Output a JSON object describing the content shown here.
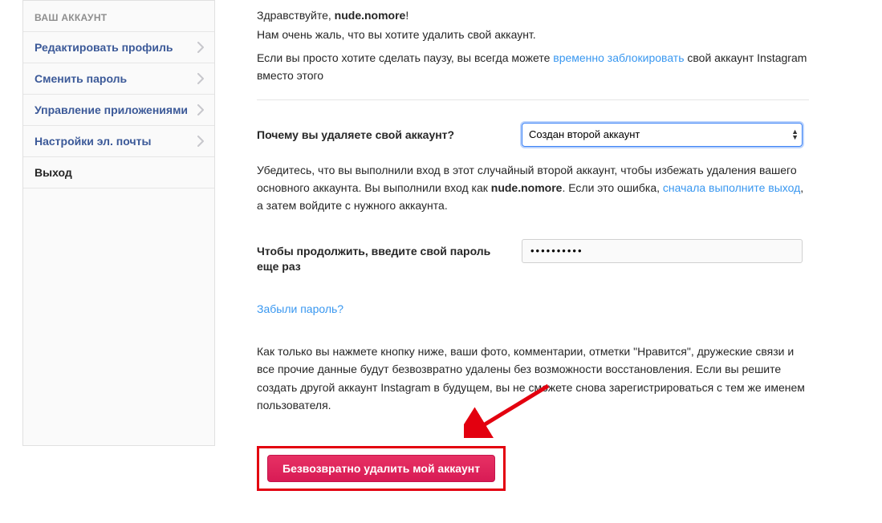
{
  "sidebar": {
    "header": "ВАШ АККАУНТ",
    "items": [
      {
        "label": "Редактировать профиль",
        "link": true,
        "chevron": true
      },
      {
        "label": "Сменить пароль",
        "link": true,
        "chevron": true
      },
      {
        "label": "Управление приложениями",
        "link": true,
        "chevron": true
      },
      {
        "label": "Настройки эл. почты",
        "link": true,
        "chevron": true
      },
      {
        "label": "Выход",
        "link": false,
        "chevron": false
      }
    ]
  },
  "main": {
    "greeting_prefix": "Здравствуйте, ",
    "username": "nude.nomore",
    "greeting_suffix": "!",
    "sorry_line": "Нам очень жаль, что вы хотите удалить свой аккаунт.",
    "pause_pre": "Если вы просто хотите сделать паузу, вы всегда можете ",
    "pause_link": "временно заблокировать",
    "pause_post": " свой аккаунт Instagram вместо этого",
    "reason_label": "Почему вы удаляете свой аккаунт?",
    "reason_selected": "Создан второй аккаунт",
    "verify_pre": "Убедитесь, что вы выполнили вход в этот случайный второй аккаунт, чтобы избежать удаления вашего основного аккаунта. Вы выполнили вход как ",
    "verify_user": "nude.nomore",
    "verify_mid": ". Если это ошибка, ",
    "verify_link": "сначала выполните выход",
    "verify_post": ", а затем войдите с нужного аккаунта.",
    "password_label": "Чтобы продолжить, введите свой пароль еще раз",
    "password_value": "••••••••••",
    "forgot_password": "Забыли пароль?",
    "final_warning": "Как только вы нажмете кнопку ниже, ваши фото, комментарии, отметки \"Нравится\", дружеские связи и все прочие данные будут безвозвратно удалены без возможности восстановления. Если вы решите создать другой аккаунт Instagram в будущем, вы не сможете снова зарегистрироваться с тем же именем пользователя.",
    "delete_button": "Безвозвратно удалить мой аккаунт"
  },
  "annotation": {
    "arrow_color": "#e3000f"
  }
}
